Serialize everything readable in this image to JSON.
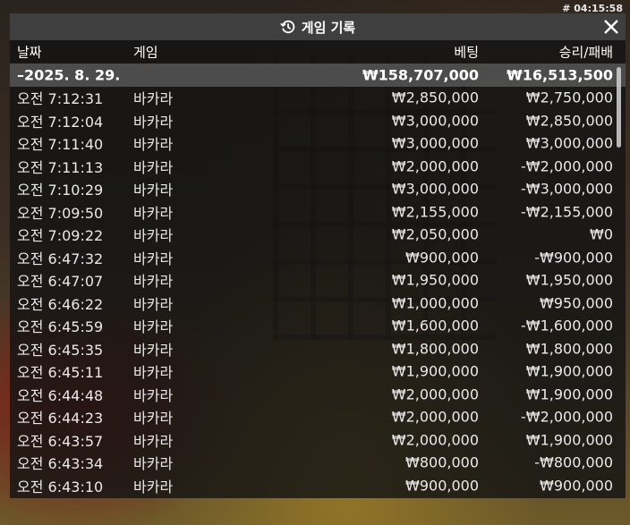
{
  "status": {
    "clock": "# 04:15:58"
  },
  "window": {
    "title": "게임 기록",
    "icon": "history-icon",
    "close_icon": "close-icon"
  },
  "columns": {
    "date": "날짜",
    "game": "게임",
    "bet": "베팅",
    "result": "승리/패배"
  },
  "summary": {
    "date": "–2025. 8. 29.",
    "bet": "₩158,707,000",
    "result": "₩16,513,500"
  },
  "rows": [
    {
      "time": "오전 7:12:31",
      "game": "바카라",
      "bet": "₩2,850,000",
      "result": "₩2,750,000"
    },
    {
      "time": "오전 7:12:04",
      "game": "바카라",
      "bet": "₩3,000,000",
      "result": "₩2,850,000"
    },
    {
      "time": "오전 7:11:40",
      "game": "바카라",
      "bet": "₩3,000,000",
      "result": "₩3,000,000"
    },
    {
      "time": "오전 7:11:13",
      "game": "바카라",
      "bet": "₩2,000,000",
      "result": "-₩2,000,000"
    },
    {
      "time": "오전 7:10:29",
      "game": "바카라",
      "bet": "₩3,000,000",
      "result": "-₩3,000,000"
    },
    {
      "time": "오전 7:09:50",
      "game": "바카라",
      "bet": "₩2,155,000",
      "result": "-₩2,155,000"
    },
    {
      "time": "오전 7:09:22",
      "game": "바카라",
      "bet": "₩2,050,000",
      "result": "₩0"
    },
    {
      "time": "오전 6:47:32",
      "game": "바카라",
      "bet": "₩900,000",
      "result": "-₩900,000"
    },
    {
      "time": "오전 6:47:07",
      "game": "바카라",
      "bet": "₩1,950,000",
      "result": "₩1,950,000"
    },
    {
      "time": "오전 6:46:22",
      "game": "바카라",
      "bet": "₩1,000,000",
      "result": "₩950,000"
    },
    {
      "time": "오전 6:45:59",
      "game": "바카라",
      "bet": "₩1,600,000",
      "result": "-₩1,600,000"
    },
    {
      "time": "오전 6:45:35",
      "game": "바카라",
      "bet": "₩1,800,000",
      "result": "₩1,800,000"
    },
    {
      "time": "오전 6:45:11",
      "game": "바카라",
      "bet": "₩1,900,000",
      "result": "₩1,900,000"
    },
    {
      "time": "오전 6:44:48",
      "game": "바카라",
      "bet": "₩2,000,000",
      "result": "₩1,900,000"
    },
    {
      "time": "오전 6:44:23",
      "game": "바카라",
      "bet": "₩2,000,000",
      "result": "-₩2,000,000"
    },
    {
      "time": "오전 6:43:57",
      "game": "바카라",
      "bet": "₩2,000,000",
      "result": "₩1,900,000"
    },
    {
      "time": "오전 6:43:34",
      "game": "바카라",
      "bet": "₩800,000",
      "result": "-₩800,000"
    },
    {
      "time": "오전 6:43:10",
      "game": "바카라",
      "bet": "₩900,000",
      "result": "₩900,000"
    }
  ]
}
